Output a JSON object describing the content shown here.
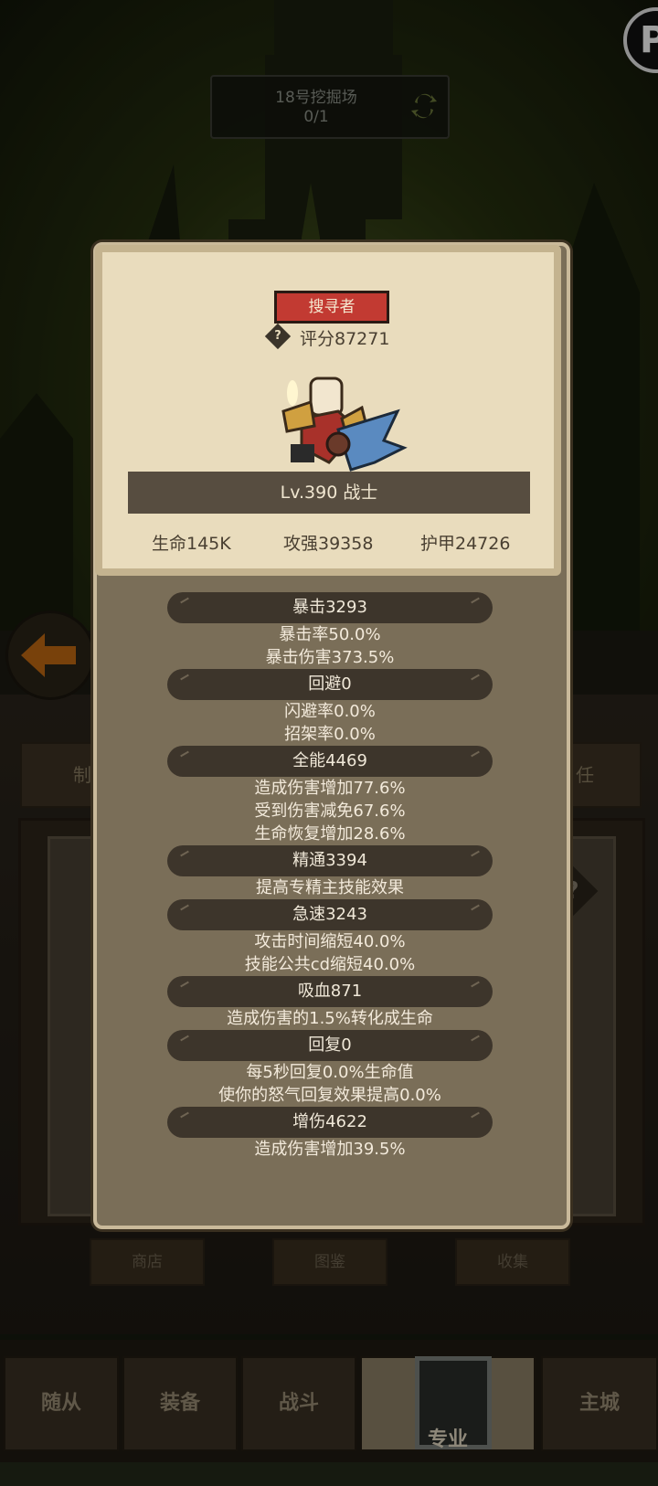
{
  "location": {
    "name": "18号挖掘场",
    "progress": "0/1"
  },
  "corner_button": {
    "icon": "logo-badge-icon"
  },
  "background_tabs": [
    "制",
    "任"
  ],
  "small_buttons": [
    "商店",
    "图鉴",
    "收集"
  ],
  "bottom_nav": [
    "随从",
    "装备",
    "战斗",
    "专业",
    "主城"
  ],
  "bottom_nav_active": "专业",
  "hero": {
    "class_tag": "搜寻者",
    "score": "评分87271",
    "level_label": "Lv.390 战士",
    "hp": "生命145K",
    "attack": "攻强39358",
    "armor": "护甲24726"
  },
  "stats": [
    {
      "header": "暴击3293",
      "lines": [
        "暴击率50.0%",
        "暴击伤害373.5%"
      ]
    },
    {
      "header": "回避0",
      "lines": [
        "闪避率0.0%",
        "招架率0.0%"
      ]
    },
    {
      "header": "全能4469",
      "lines": [
        "造成伤害增加77.6%",
        "受到伤害减免67.6%",
        "生命恢复增加28.6%"
      ]
    },
    {
      "header": "精通3394",
      "lines": [
        "提高专精主技能效果"
      ]
    },
    {
      "header": "急速3243",
      "lines": [
        "攻击时间缩短40.0%",
        "技能公共cd缩短40.0%"
      ]
    },
    {
      "header": "吸血871",
      "lines": [
        "造成伤害的1.5%转化成生命"
      ]
    },
    {
      "header": "回复0",
      "lines": [
        "每5秒回复0.0%生命值",
        "使你的怒气回复效果提高0.0%"
      ]
    },
    {
      "header": "增伤4622",
      "lines": [
        "造成伤害增加39.5%"
      ]
    }
  ],
  "colors": {
    "tag_red": "#c23a32",
    "parchment": "#e9dcbd",
    "panel": "#7a6e58"
  }
}
